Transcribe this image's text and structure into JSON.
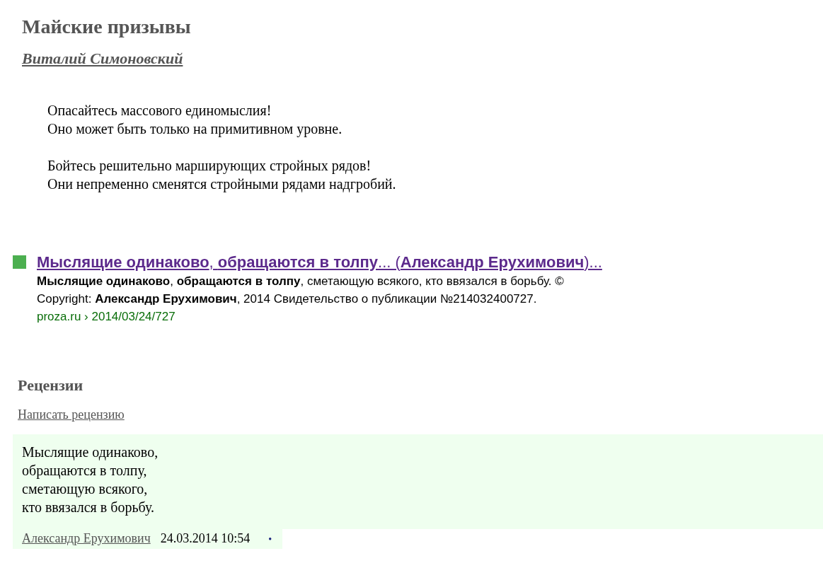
{
  "title": "Майские призывы",
  "author": "Виталий Симоновский",
  "poem": [
    [
      "Опасайтесь массового единомыслия!",
      "Оно может быть только на примитивном уровне."
    ],
    [
      "Бойтесь решительно марширующих стройных рядов!",
      "Они непременно сменятся стройными рядами надгробий."
    ]
  ],
  "search_result": {
    "title": "**Мыслящие одинаково**, **обращаются в толпу**... (**Александр Ерухимович**)...",
    "snippet_lines": [
      "**Мыслящие одинаково**, **обращаются в толпу**, сметающую всякого, кто ввязался в борьбу. ©",
      "Copyright: **Александр Ерухимович**, 2014 Свидетельство о публикации №214032400727."
    ],
    "url": "proza.ru › 2014/03/24/727"
  },
  "reviews_heading": "Рецензии",
  "write_review": "Написать рецензию",
  "reviews": [
    {
      "lines": [
        "Мыслящие одинаково,",
        "обращаются в толпу,",
        "сметающую всякого,",
        "кто ввязался в борьбу."
      ],
      "author": "Александр Ерухимович",
      "date": "24.03.2014 10:54",
      "bullet": "•"
    }
  ]
}
